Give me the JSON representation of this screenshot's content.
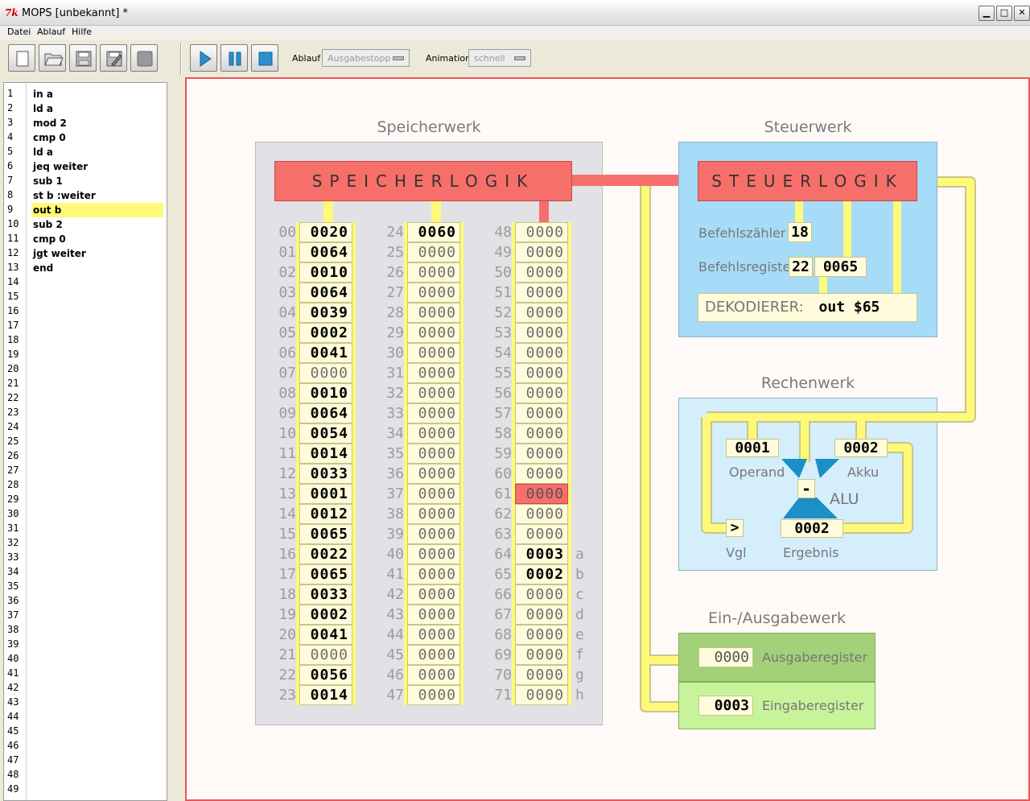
{
  "window": {
    "icon": "tk-feather-icon",
    "icon_text": "7k",
    "title": "MOPS   [unbekannt] *",
    "min": "▁",
    "max": "□",
    "close": "✕"
  },
  "menu": [
    "Datei",
    "Ablauf",
    "Hilfe"
  ],
  "toolbar": {
    "file_buttons": [
      "new-file-icon",
      "open-folder-icon",
      "save-icon",
      "save-as-icon",
      "disabled-icon"
    ],
    "run_buttons": [
      "play-icon",
      "pause-icon",
      "stop-icon"
    ],
    "ablauf_label": "Ablauf",
    "ablauf_value": "Ausgabestopp",
    "animation_label": "Animation",
    "animation_value": "schnell"
  },
  "editor": {
    "line_count": 49,
    "lines": [
      "in a",
      "ld a",
      "mod 2",
      "cmp 0",
      "ld a",
      "jeq weiter",
      "sub 1",
      "st b :weiter",
      "out b",
      "sub 2",
      "cmp 0",
      "jgt weiter",
      "end"
    ],
    "highlight_line": 9
  },
  "memory": {
    "title": "Speicherwerk",
    "logic": "SPEICHERLOGIK",
    "col1": {
      "addrs": [
        "00",
        "01",
        "02",
        "03",
        "04",
        "05",
        "06",
        "07",
        "08",
        "09",
        "10",
        "11",
        "12",
        "13",
        "14",
        "15",
        "16",
        "17",
        "18",
        "19",
        "20",
        "21",
        "22",
        "23"
      ],
      "values": [
        "0020",
        "0064",
        "0010",
        "0064",
        "0039",
        "0002",
        "0041",
        "0000",
        "0010",
        "0064",
        "0054",
        "0014",
        "0033",
        "0001",
        "0012",
        "0065",
        "0022",
        "0065",
        "0033",
        "0002",
        "0041",
        "0000",
        "0056",
        "0014"
      ]
    },
    "col2": {
      "addrs": [
        "24",
        "25",
        "26",
        "27",
        "28",
        "29",
        "30",
        "31",
        "32",
        "33",
        "34",
        "35",
        "36",
        "37",
        "38",
        "39",
        "40",
        "41",
        "42",
        "43",
        "44",
        "45",
        "46",
        "47"
      ],
      "values": [
        "0060",
        "0000",
        "0000",
        "0000",
        "0000",
        "0000",
        "0000",
        "0000",
        "0000",
        "0000",
        "0000",
        "0000",
        "0000",
        "0000",
        "0000",
        "0000",
        "0000",
        "0000",
        "0000",
        "0000",
        "0000",
        "0000",
        "0000",
        "0000"
      ]
    },
    "col3": {
      "addrs": [
        "48",
        "49",
        "50",
        "51",
        "52",
        "53",
        "54",
        "55",
        "56",
        "57",
        "58",
        "59",
        "60",
        "61",
        "62",
        "63",
        "64",
        "65",
        "66",
        "67",
        "68",
        "69",
        "70",
        "71"
      ],
      "values": [
        "0000",
        "0000",
        "0000",
        "0000",
        "0000",
        "0000",
        "0000",
        "0000",
        "0000",
        "0000",
        "0000",
        "0000",
        "0000",
        "0000",
        "0000",
        "0000",
        "0003",
        "0002",
        "0000",
        "0000",
        "0000",
        "0000",
        "0000",
        "0000"
      ],
      "suffixes": [
        "",
        "",
        "",
        "",
        "",
        "",
        "",
        "",
        "",
        "",
        "",
        "",
        "",
        "",
        "",
        "",
        "a",
        "b",
        "c",
        "d",
        "e",
        "f",
        "g",
        "h"
      ]
    }
  },
  "control": {
    "title": "Steuerwerk",
    "logic": "STEUERLOGIK",
    "pc_label": "Befehlszähler",
    "pc": "18",
    "ir_label": "Befehlsregister",
    "ir_op": "22",
    "ir_arg": "0065",
    "dec_label": "DEKODIERER:",
    "dec_value": "out $65"
  },
  "alu": {
    "title": "Rechenwerk",
    "operand": "0001",
    "operand_label": "Operand",
    "akku": "0002",
    "akku_label": "Akku",
    "op": "-",
    "alu_label": "ALU",
    "cmp": ">",
    "cmp_label": "Vgl",
    "result": "0002",
    "result_label": "Ergebnis"
  },
  "io": {
    "title": "Ein-/Ausgabewerk",
    "out_value": "0000",
    "out_label": "Ausgaberegister",
    "in_value": "0003",
    "in_label": "Eingaberegister"
  }
}
